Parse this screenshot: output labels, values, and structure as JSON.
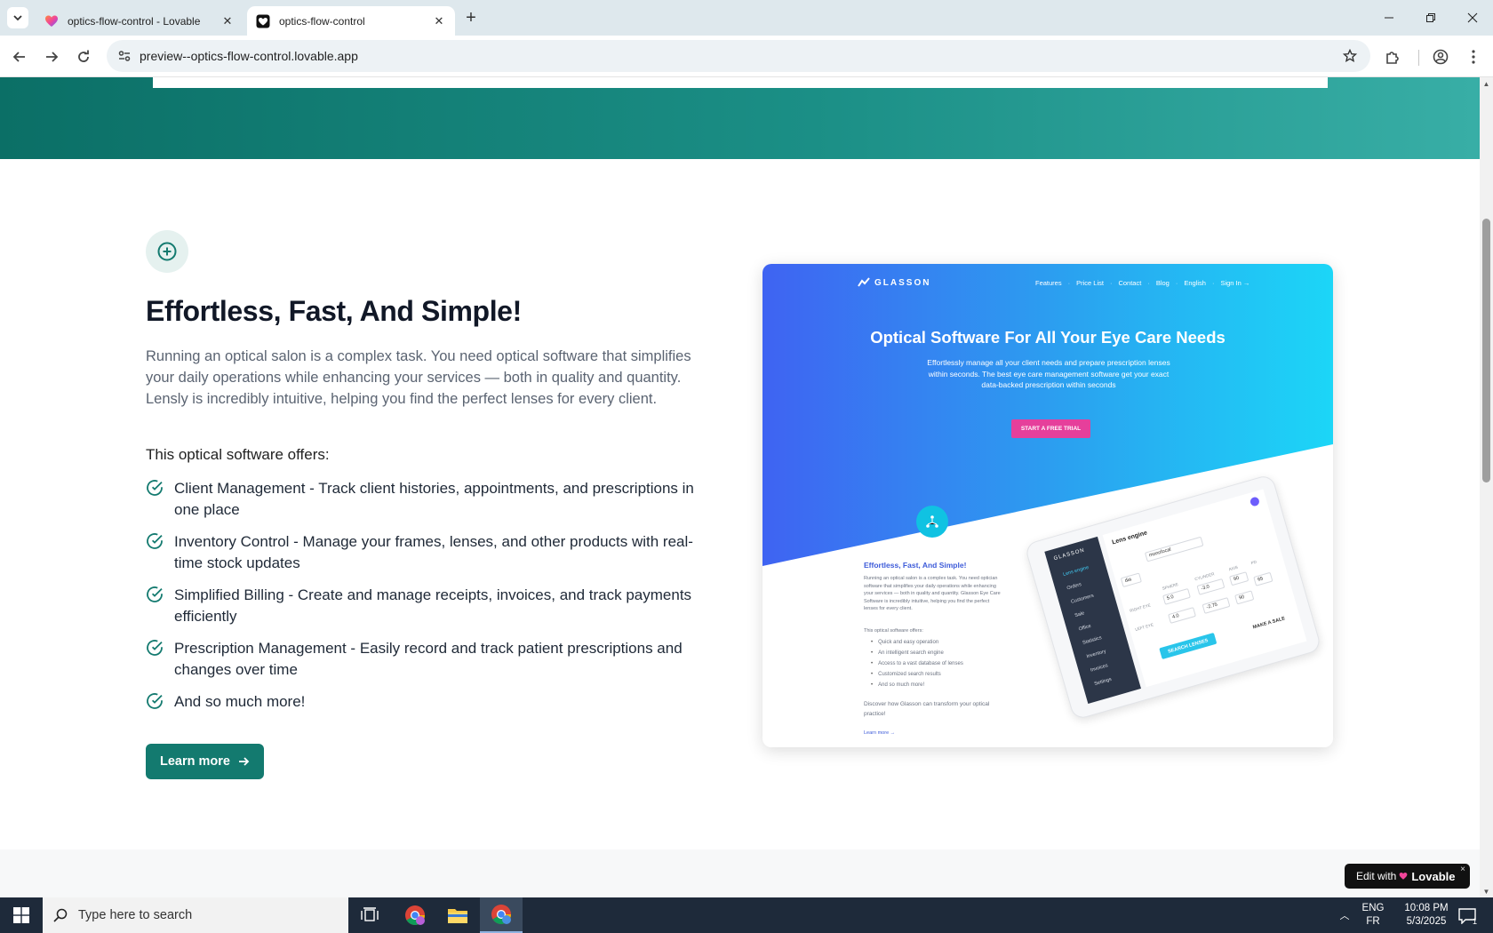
{
  "browser": {
    "tabs": [
      {
        "title": "optics-flow-control - Lovable",
        "favicon": "lovable-heart-icon",
        "active": false
      },
      {
        "title": "optics-flow-control",
        "favicon": "heart-icon",
        "active": true
      }
    ],
    "url": "preview--optics-flow-control.lovable.app"
  },
  "section": {
    "title": "Effortless, Fast, And Simple!",
    "description": "Running an optical salon is a complex task. You need optical software that simplifies your daily operations while enhancing your services — both in quality and quantity. Lensly is incredibly intuitive, helping you find the perfect lenses for every client.",
    "offers_heading": "This optical software offers:",
    "features": [
      "Client Management - Track client histories, appointments, and prescriptions in one place",
      "Inventory Control - Manage your frames, lenses, and other products with real-time stock updates",
      "Simplified Billing - Create and manage receipts, invoices, and track payments efficiently",
      "Prescription Management - Easily record and track patient prescriptions and changes over time",
      "And so much more!"
    ],
    "learn_more": "Learn more",
    "accent_color": "#137a6f"
  },
  "preview": {
    "logo": "GLASSON",
    "nav": [
      "Features",
      "Price List",
      "Contact",
      "Blog",
      "English",
      "Sign In →"
    ],
    "title": "Optical Software For All Your Eye Care Needs",
    "subtitle": "Effortlessly manage all your client needs and prepare prescription lenses within seconds. The best eye care management software get your exact data-backed prescription within seconds",
    "cta": "START A FREE TRIAL",
    "heading": "Effortless, Fast, And Simple!",
    "paragraph": "Running an optical salon is a complex task. You need optician software that simplifies your daily operations while enhancing your services — both in quality and quantity. Glasson Eye Care Software is incredibly intuitive, helping you find the perfect lenses for every client.",
    "offers": "This optical software offers:",
    "list": [
      "Quick and easy operation",
      "An intelligent search engine",
      "Access to a vast database of lenses",
      "Customized search results",
      "And so much more!"
    ],
    "discover": "Discover how Glasson can transform your optical practice!",
    "learn": "Learn more →",
    "app": {
      "title": "Lens engine",
      "sidebar": [
        "Lens engine",
        "Orders",
        "Customers",
        "Sale",
        "Office",
        "Statistics",
        "Inventory",
        "Invoices",
        "Settings"
      ],
      "type_value": "monofocal",
      "index_value": "dia",
      "right_eye_label": "RIGHT EYE",
      "left_eye_label": "LEFT EYE",
      "sphere_label": "SPHERE",
      "cylinder_label": "CYLINDER",
      "axis_label": "AXIS",
      "pd_label": "PD",
      "re_sphere": "5.0",
      "re_cylinder": "-3.0",
      "re_axis": "90",
      "le_sphere": "4.0",
      "le_cylinder": "-2.75",
      "le_axis": "90",
      "pd": "65",
      "search": "SEARCH LENSES",
      "sale": "MAKE A SALE"
    }
  },
  "badge": {
    "prefix": "Edit with",
    "brand": "Lovable",
    "close": "×"
  },
  "taskbar": {
    "search_placeholder": "Type here to search",
    "lang_1": "ENG",
    "lang_2": "FR",
    "time": "10:08 PM",
    "date": "5/3/2025",
    "notifications": "1"
  }
}
